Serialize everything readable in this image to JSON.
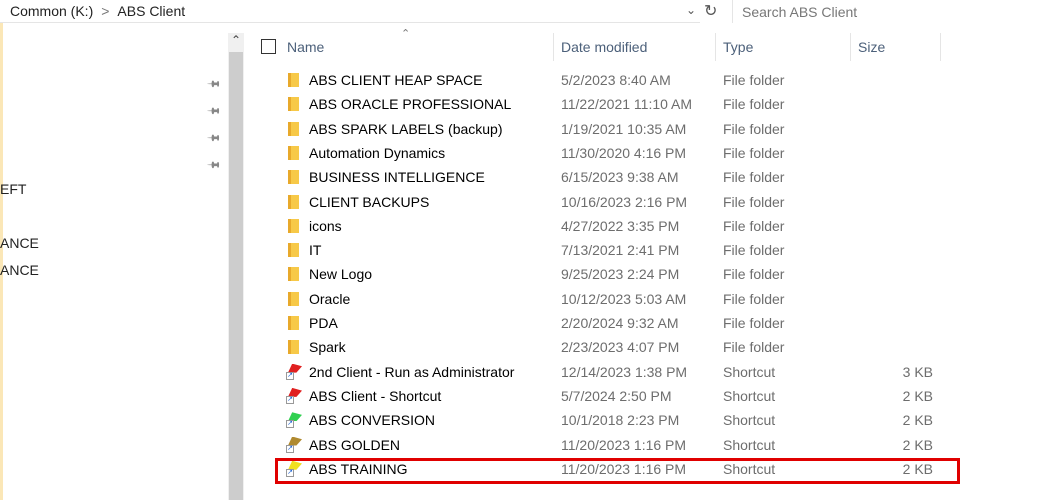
{
  "address": {
    "crumbs": [
      "Common (K:)",
      "ABS Client"
    ]
  },
  "search": {
    "placeholder": "Search ABS Client"
  },
  "nav": {
    "items": [
      "EFT",
      "ANCE",
      "ANCE"
    ]
  },
  "columns": {
    "name": "Name",
    "date": "Date modified",
    "type": "Type",
    "size": "Size"
  },
  "files": [
    {
      "name": "ABS CLIENT HEAP SPACE",
      "date": "5/2/2023 8:40 AM",
      "type": "File folder",
      "size": "",
      "icon": "folder"
    },
    {
      "name": "ABS ORACLE PROFESSIONAL",
      "date": "11/22/2021 11:10 AM",
      "type": "File folder",
      "size": "",
      "icon": "folder"
    },
    {
      "name": "ABS SPARK LABELS (backup)",
      "date": "1/19/2021 10:35 AM",
      "type": "File folder",
      "size": "",
      "icon": "folder"
    },
    {
      "name": "Automation Dynamics",
      "date": "11/30/2020 4:16 PM",
      "type": "File folder",
      "size": "",
      "icon": "folder"
    },
    {
      "name": "BUSINESS INTELLIGENCE",
      "date": "6/15/2023 9:38 AM",
      "type": "File folder",
      "size": "",
      "icon": "folder"
    },
    {
      "name": "CLIENT BACKUPS",
      "date": "10/16/2023 2:16 PM",
      "type": "File folder",
      "size": "",
      "icon": "folder"
    },
    {
      "name": "icons",
      "date": "4/27/2022 3:35 PM",
      "type": "File folder",
      "size": "",
      "icon": "folder"
    },
    {
      "name": "IT",
      "date": "7/13/2021 2:41 PM",
      "type": "File folder",
      "size": "",
      "icon": "folder"
    },
    {
      "name": "New Logo",
      "date": "9/25/2023 2:24 PM",
      "type": "File folder",
      "size": "",
      "icon": "folder"
    },
    {
      "name": "Oracle",
      "date": "10/12/2023 5:03 AM",
      "type": "File folder",
      "size": "",
      "icon": "folder"
    },
    {
      "name": "PDA",
      "date": "2/20/2024 9:32 AM",
      "type": "File folder",
      "size": "",
      "icon": "folder"
    },
    {
      "name": "Spark",
      "date": "2/23/2023 4:07 PM",
      "type": "File folder",
      "size": "",
      "icon": "folder"
    },
    {
      "name": "2nd Client - Run as Administrator",
      "date": "12/14/2023 1:38 PM",
      "type": "Shortcut",
      "size": "3 KB",
      "icon": "shortcut",
      "color": "#e02020"
    },
    {
      "name": "ABS Client - Shortcut",
      "date": "5/7/2024 2:50 PM",
      "type": "Shortcut",
      "size": "2 KB",
      "icon": "shortcut",
      "color": "#e02020"
    },
    {
      "name": "ABS CONVERSION",
      "date": "10/1/2018 2:23 PM",
      "type": "Shortcut",
      "size": "2 KB",
      "icon": "shortcut",
      "color": "#30d050"
    },
    {
      "name": "ABS GOLDEN",
      "date": "11/20/2023 1:16 PM",
      "type": "Shortcut",
      "size": "2 KB",
      "icon": "shortcut",
      "color": "#b08a30"
    },
    {
      "name": "ABS TRAINING",
      "date": "11/20/2023 1:16 PM",
      "type": "Shortcut",
      "size": "2 KB",
      "icon": "shortcut",
      "color": "#f0e020"
    }
  ],
  "highlight_color": "#e00000"
}
